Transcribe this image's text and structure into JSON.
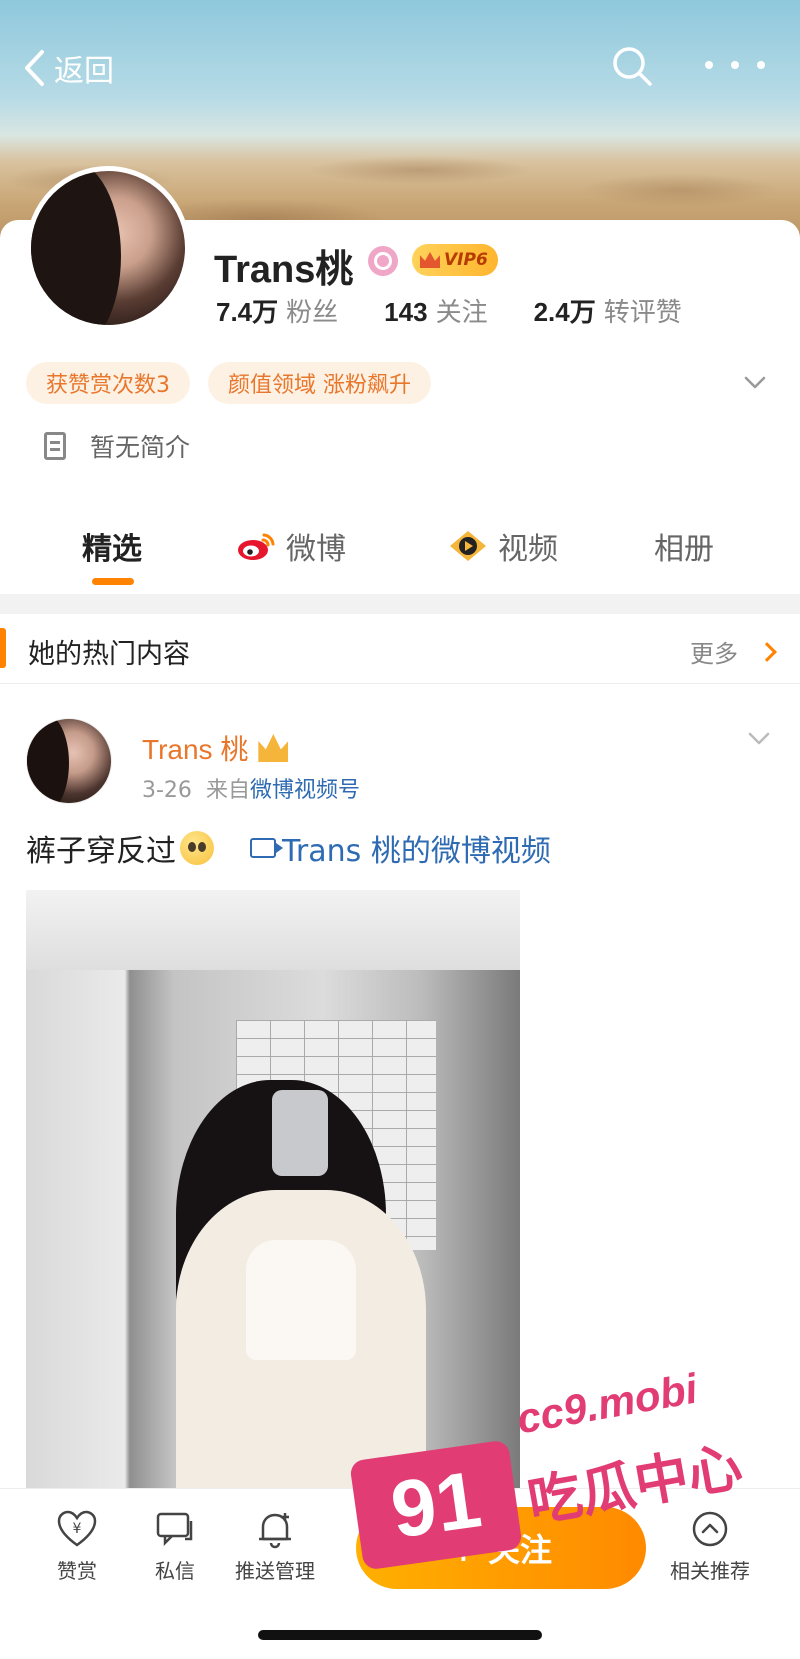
{
  "header": {
    "back_label": "返回"
  },
  "profile": {
    "name": "Trans桃",
    "vip_label": "VIP6",
    "stats": [
      {
        "value": "7.4万",
        "label": "粉丝"
      },
      {
        "value": "143",
        "label": "关注"
      },
      {
        "value": "2.4万",
        "label": "转评赞"
      }
    ],
    "tags": [
      "获赞赏次数3",
      "颜值领域 涨粉飙升"
    ],
    "bio": "暂无简介"
  },
  "tabs": [
    {
      "label": "精选",
      "active": true
    },
    {
      "label": "微博",
      "active": false
    },
    {
      "label": "视频",
      "active": false
    },
    {
      "label": "相册",
      "active": false
    }
  ],
  "hot_section": {
    "title": "她的热门内容",
    "more_label": "更多"
  },
  "post": {
    "author": "Trans 桃",
    "date": "3-26",
    "source_prefix": "来自",
    "source": "微博视频号",
    "text": "裤子穿反过",
    "video_link": "Trans 桃的微博视频"
  },
  "bottom_bar": {
    "items": [
      {
        "label": "赞赏",
        "icon": "reward-icon"
      },
      {
        "label": "私信",
        "icon": "message-icon"
      },
      {
        "label": "推送管理",
        "icon": "bell-icon"
      },
      {
        "label": "相关推荐",
        "icon": "chevron-up-circle-icon"
      }
    ],
    "follow_label": "+ 关注"
  },
  "watermark": {
    "badge": "91",
    "url": "cc9.mobi",
    "text": "吃瓜中心"
  },
  "colors": {
    "accent": "#ff8200",
    "link": "#2f6bb2",
    "tag_bg": "#fdf1e4",
    "tag_text": "#e8772c"
  }
}
